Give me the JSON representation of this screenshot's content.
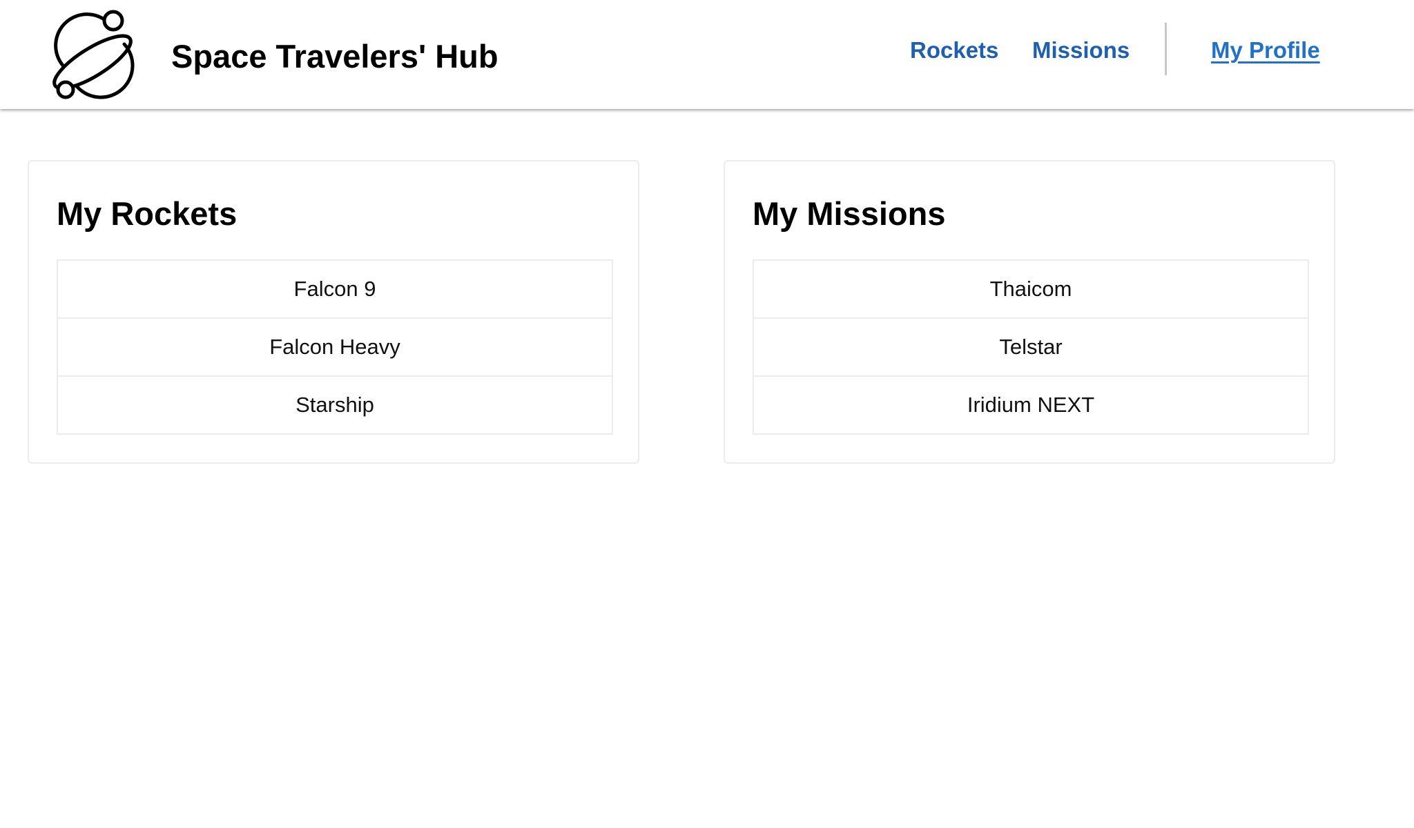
{
  "header": {
    "brand_title": "Space Travelers' Hub",
    "logo_icon": "planet-logo-icon",
    "nav": {
      "rockets_label": "Rockets",
      "missions_label": "Missions",
      "profile_label": "My Profile",
      "active": "My Profile"
    }
  },
  "main": {
    "rockets_card": {
      "title": "My Rockets",
      "items": [
        "Falcon 9",
        "Falcon Heavy",
        "Starship"
      ]
    },
    "missions_card": {
      "title": "My Missions",
      "items": [
        "Thaicom",
        "Telstar",
        "Iridium NEXT"
      ]
    }
  },
  "colors": {
    "nav_link": "#1e5fb0",
    "nav_active": "#2171c9",
    "border": "#ececec",
    "divider": "#c8c8c8"
  }
}
